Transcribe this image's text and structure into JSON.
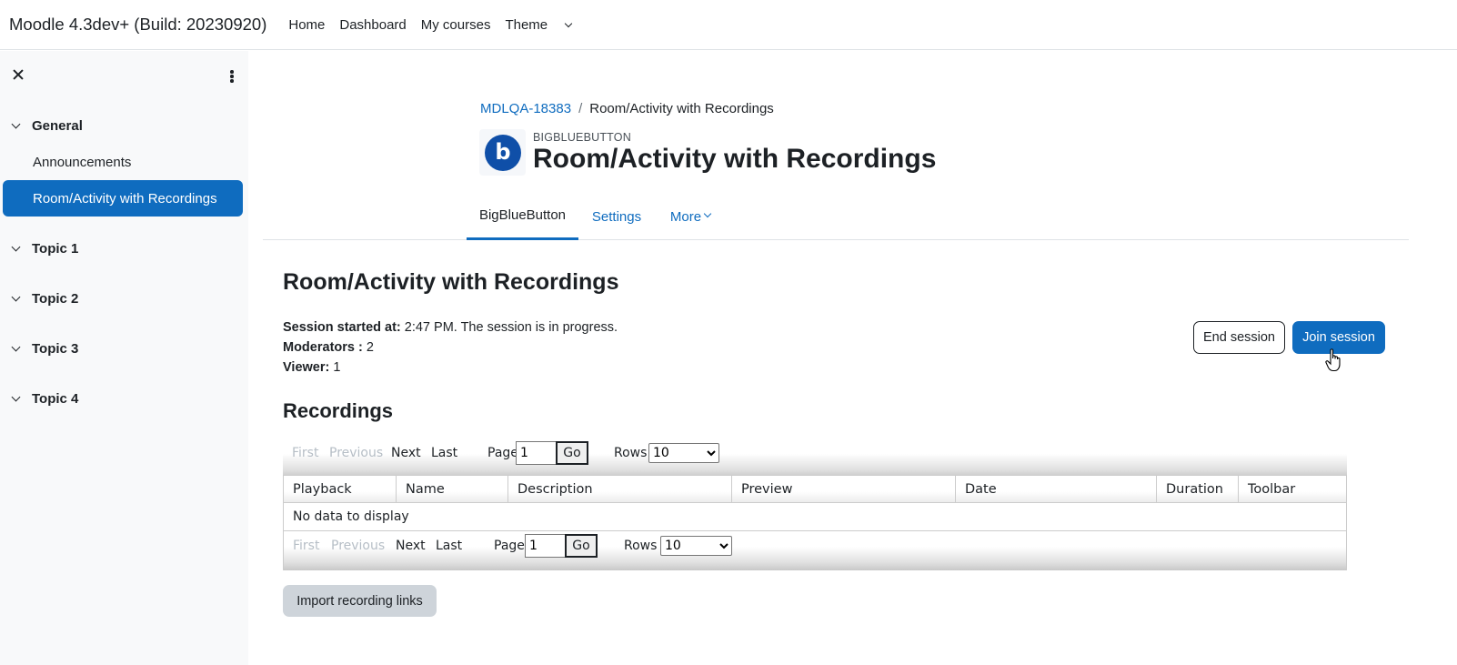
{
  "app": {
    "brand": "Moodle 4.3dev+ (Build: 20230920)",
    "nav": [
      "Home",
      "Dashboard",
      "My courses",
      "Theme"
    ]
  },
  "drawer": {
    "sections": [
      {
        "title": "General",
        "items": [
          "Announcements",
          "Room/Activity with Recordings"
        ]
      },
      {
        "title": "Topic 1"
      },
      {
        "title": "Topic 2"
      },
      {
        "title": "Topic 3"
      },
      {
        "title": "Topic 4"
      }
    ]
  },
  "breadcrumb": {
    "course": "MDLQA-18383",
    "separator": "/",
    "current": "Room/Activity with Recordings"
  },
  "module": {
    "icon_letter": "b",
    "type": "BIGBLUEBUTTON",
    "title": "Room/Activity with Recordings"
  },
  "tabs": [
    "BigBlueButton",
    "Settings",
    "More"
  ],
  "content": {
    "heading": "Room/Activity with Recordings",
    "session_label": "Session started at:",
    "session_value": " 2:47 PM. The session is in progress.",
    "moderators_label": "Moderators :",
    "moderators_value": " 2",
    "viewer_label": "Viewer:",
    "viewer_value": " 1",
    "end_button": "End session",
    "join_button": "Join session",
    "recordings_heading": "Recordings",
    "import_button": "Import recording links"
  },
  "pager": {
    "first": "First",
    "previous": "Previous",
    "next": "Next",
    "last": "Last",
    "page_label": "Page",
    "page_value": "1",
    "go": "Go",
    "rows_label": "Rows",
    "rows_value": "10"
  },
  "table": {
    "columns": [
      "Playback",
      "Name",
      "Description",
      "Preview",
      "Date",
      "Duration",
      "Toolbar"
    ],
    "empty_message": "No data to display"
  },
  "colors": {
    "primary": "#0f6cbf",
    "drawer_bg": "#f8f9fa",
    "icon_bg": "#0f4fa8"
  }
}
